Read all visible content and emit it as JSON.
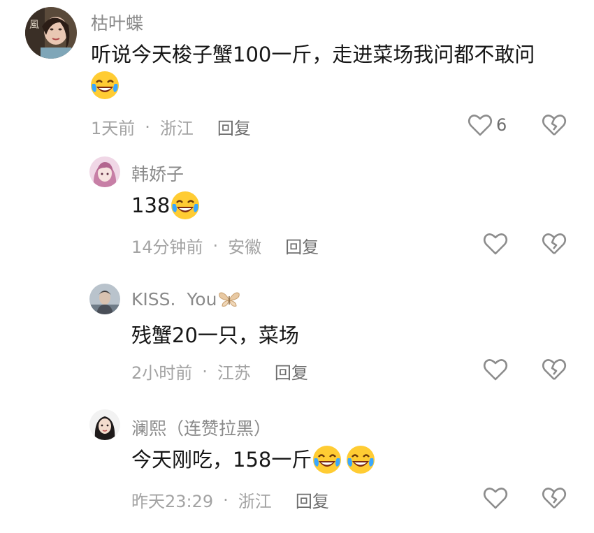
{
  "comments": [
    {
      "username": "枯叶蝶",
      "text_line1": "听说今天梭子蟹100一斤，走进菜场我问都不敢问",
      "time": "1天前",
      "location": "浙江",
      "reply": "回复",
      "likes": "6",
      "emoji": "laughing-crying"
    },
    {
      "username": "韩娇子",
      "text": "138",
      "time": "14分钟前",
      "location": "安徽",
      "reply": "回复",
      "emoji": "laughing-crying"
    },
    {
      "username": "KISS.  You",
      "username_icon": "butterfly-icon",
      "text": "残蟹20一只，菜场",
      "time": "2小时前",
      "location": "江苏",
      "reply": "回复"
    },
    {
      "username": "澜熙（连赞拉黑）",
      "text": "今天刚吃，158一斤",
      "time": "昨天23:29",
      "location": "浙江",
      "reply": "回复",
      "emoji": "laughing-crying"
    }
  ],
  "colors": {
    "username": "#8a8a8a",
    "body_text": "#161616",
    "meta_text": "#a3a3a3",
    "icon_stroke": "#8c8c8c"
  }
}
